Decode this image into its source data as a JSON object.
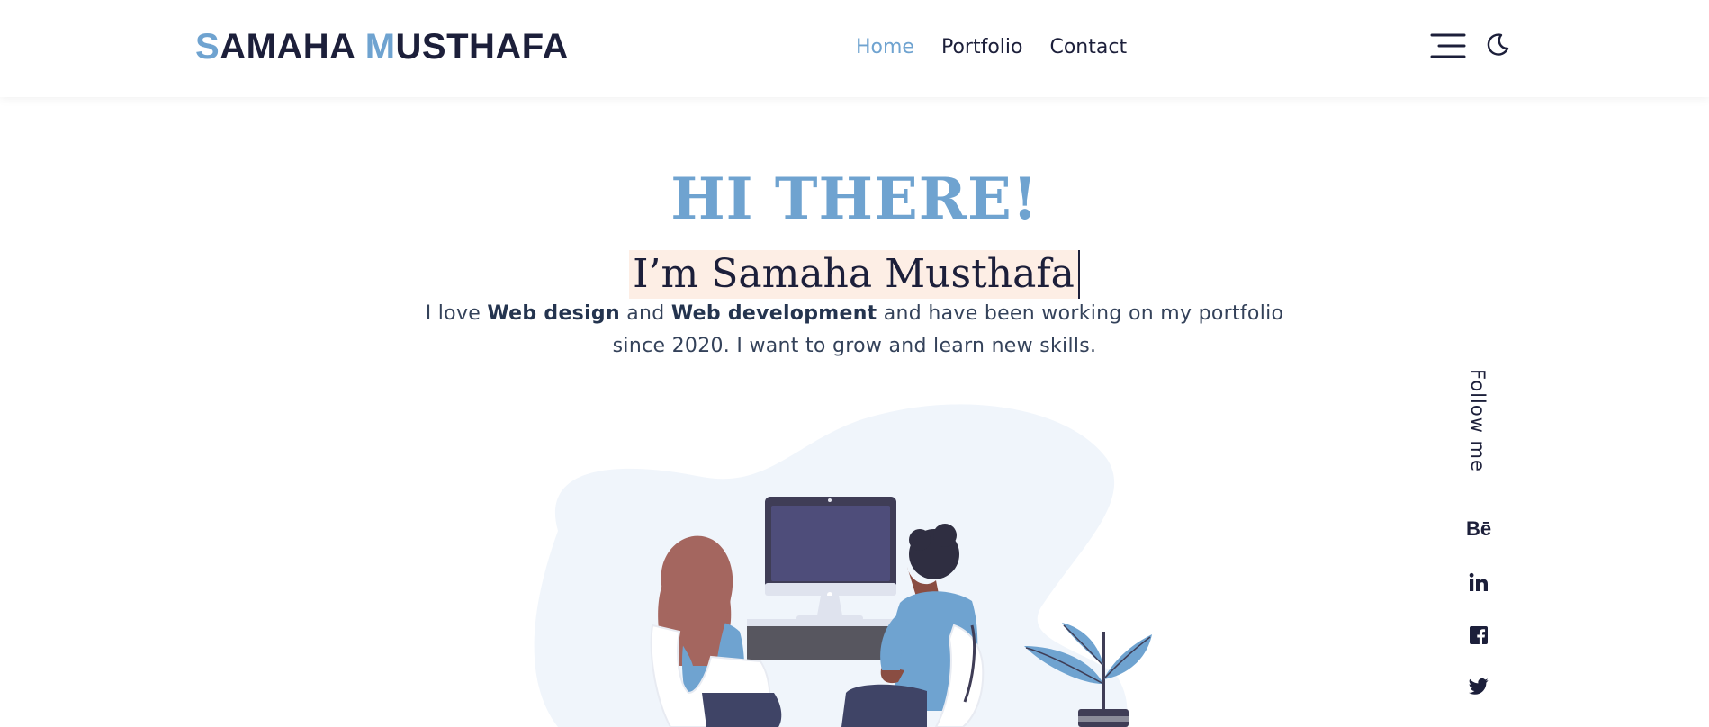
{
  "header": {
    "logo": {
      "first_initial": "S",
      "first_rest": "AMAHA ",
      "last_initial": "M",
      "last_rest": "USTHAFA"
    },
    "nav": [
      {
        "label": "Home",
        "active": true
      },
      {
        "label": "Portfolio",
        "active": false
      },
      {
        "label": "Contact",
        "active": false
      }
    ],
    "menu_icon": "hamburger-menu-icon",
    "theme_icon": "moon-icon"
  },
  "hero": {
    "greeting": "HI THERE!",
    "name_line": "I’m Samaha Musthafa",
    "intro": {
      "part1": "I love ",
      "bold1": "Web design",
      "part2": " and ",
      "bold2": "Web development",
      "part3": " and have been working on my portfolio since 2020. I want to grow and learn new skills."
    }
  },
  "social": {
    "label": "Follow me",
    "items": [
      {
        "name": "behance",
        "text": "Bē"
      },
      {
        "name": "linkedin",
        "text": "in"
      },
      {
        "name": "facebook",
        "text": "f"
      },
      {
        "name": "twitter",
        "text": "twitter"
      }
    ]
  },
  "colors": {
    "accent": "#6fa3d0",
    "text": "#1c1f3a",
    "highlight": "#fdeee5",
    "blob": "#f0f5fb"
  }
}
